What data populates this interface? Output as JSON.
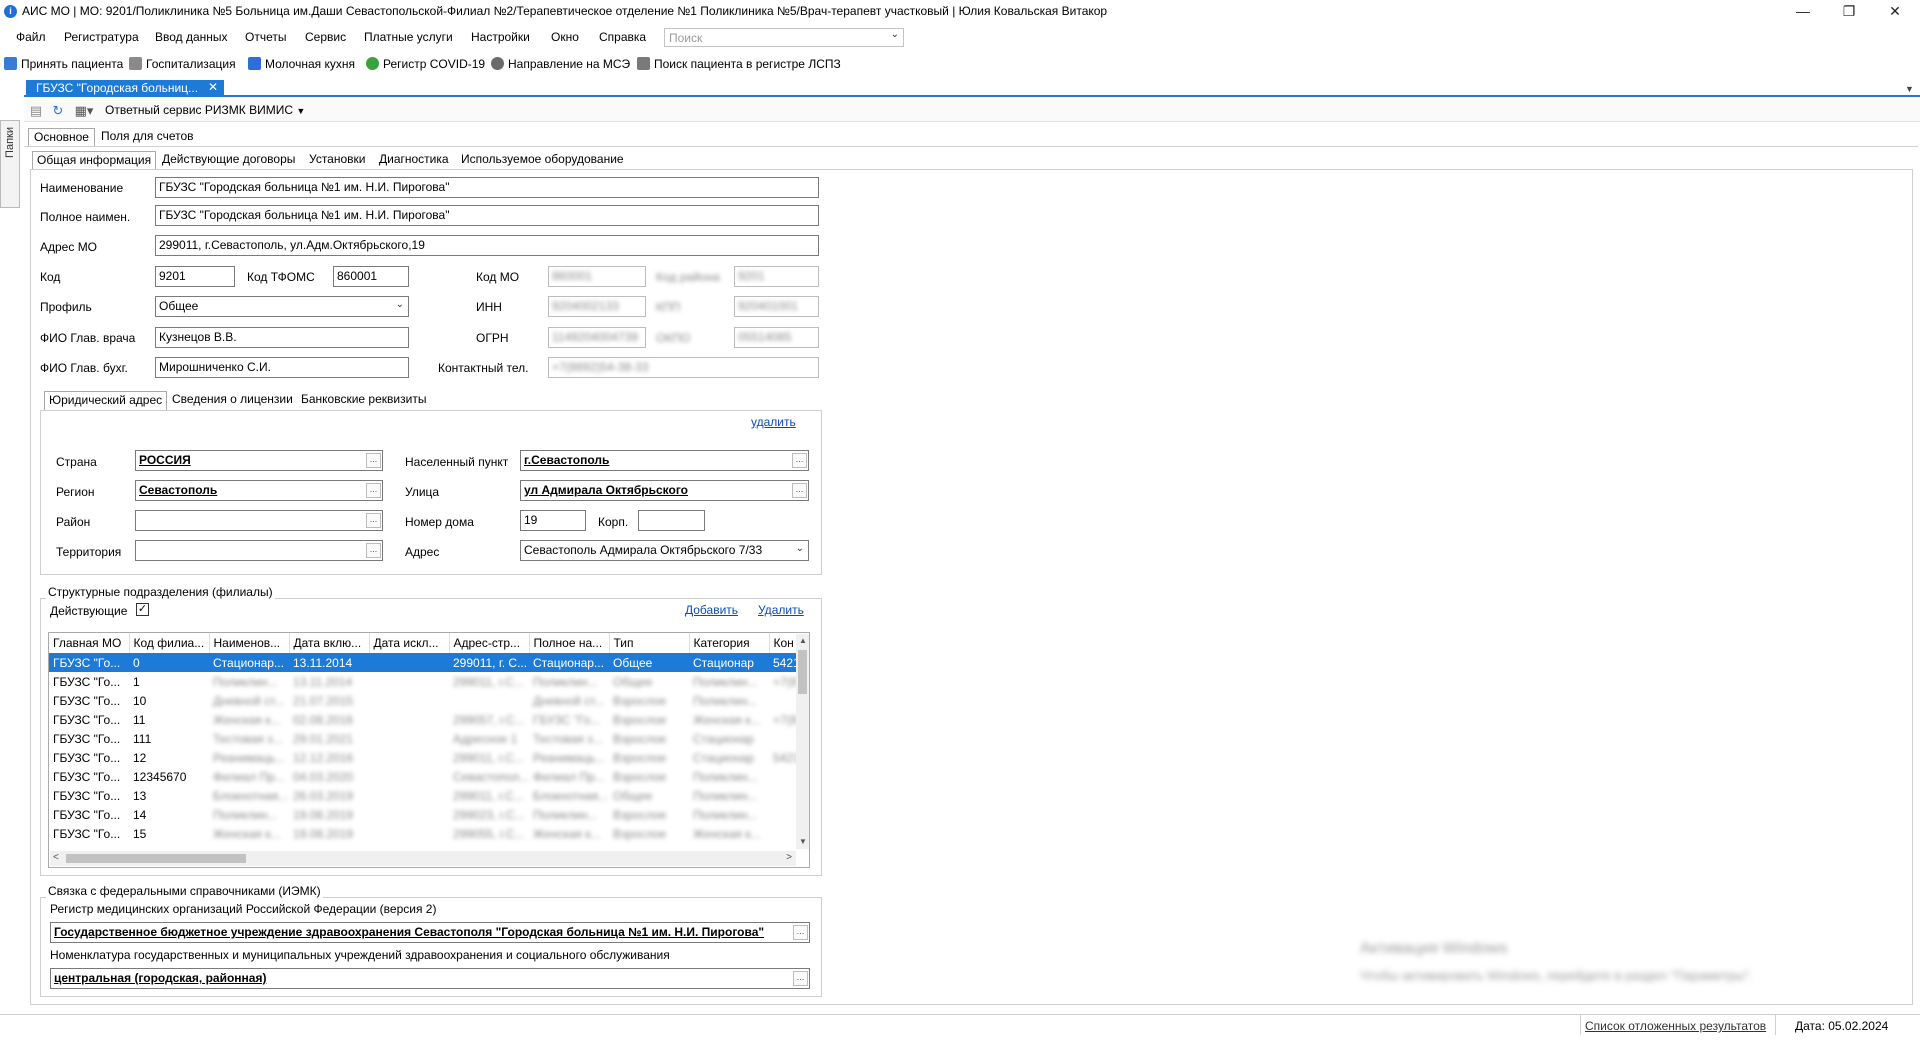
{
  "window": {
    "title": "АИС МО | МО: 9201/Поликлиника №5 Больница им.Даши Севастопольской-Филиал №2/Терапевтическое отделение №1 Поликлиника №5/Врач-терапевт участковый | Юлия Ковальская Витакор",
    "minimize": "—",
    "maximize": "❐",
    "close": "✕"
  },
  "menu": [
    "Файл",
    "Регистратура",
    "Ввод данных",
    "Отчеты",
    "Сервис",
    "Платные услуги",
    "Настройки",
    "Окно",
    "Справка"
  ],
  "search": {
    "placeholder": "Поиск"
  },
  "toolbar": [
    "Принять пациента",
    "Госпитализация",
    "Молочная кухня",
    "Регистр COVID-19",
    "Направление на МСЭ",
    "Поиск пациента в регистре ЛСПЗ"
  ],
  "doc_tab": {
    "label": "ГБУЗС \"Городская больниц...",
    "close": "✕"
  },
  "left_panel": {
    "label": "Папки"
  },
  "icon_toolbar": {
    "service": "Ответный сервис РИЗМК ВИМИС"
  },
  "main_tabs": [
    "Основное",
    "Поля для счетов"
  ],
  "sub_tabs": [
    "Общая информация",
    "Действующие договоры",
    "Установки",
    "Диагностика",
    "Используемое оборудование"
  ],
  "form": {
    "name_label": "Наименование",
    "name": "ГБУЗС \"Городская больница №1 им. Н.И. Пирогова\"",
    "fullname_label": "Полное наимен.",
    "fullname": "ГБУЗС \"Городская больница №1 им. Н.И. Пирогова\"",
    "address_label": "Адрес МО",
    "address": "299011, г.Севастополь, ул.Адм.Октябрьского,19",
    "code_label": "Код",
    "code": "9201",
    "tfoms_label": "Код ТФОМС",
    "tfoms": "860001",
    "kodmo_label": "Код МО",
    "kodmo": "860001",
    "kodrayona_label": "Код района",
    "kodrayona": "9201",
    "profile_label": "Профиль",
    "profile": "Общее",
    "inn_label": "ИНН",
    "inn": "9204002133",
    "kpp_label": "КПП",
    "kpp": "920401001",
    "chief_label": "ФИО Глав. врача",
    "chief": "Кузнецов В.В.",
    "ogrn_label": "ОГРН",
    "ogrn": "1149204004739",
    "okpo_label": "ОКПО",
    "okpo": "05514085",
    "accountant_label": "ФИО Глав. бухг.",
    "accountant": "Мирошниченко С.И.",
    "phone_label": "Контактный тел.",
    "phone": "+7(8692)54-38-33"
  },
  "address_tabs": [
    "Юридический адрес",
    "Сведения о лицензии",
    "Банковские реквизиты"
  ],
  "address_panel": {
    "delete": "удалить",
    "country_label": "Страна",
    "country": "РОССИЯ",
    "region_label": "Регион",
    "region": "Севастополь",
    "district_label": "Район",
    "district": "",
    "territory_label": "Территория",
    "territory": "",
    "locality_label": "Населенный пункт",
    "locality": "г.Севастополь",
    "street_label": "Улица",
    "street": "ул Адмирала Октябрьского",
    "house_label": "Номер дома",
    "house": "19",
    "korp_label": "Корп.",
    "korp": "",
    "addr_label": "Адрес",
    "addr": "Севастополь Адмирала Октябрьского 7/33",
    "ellipsis": "..."
  },
  "branches": {
    "title": "Структурные подразделения (филиалы)",
    "active_label": "Действующие",
    "add": "Добавить",
    "delete": "Удалить",
    "columns": [
      "Главная МО",
      "Код филиа...",
      "Наименов...",
      "Дата вклю...",
      "Дата искл...",
      "Адрес-стр...",
      "Полное на...",
      "Тип",
      "Категория",
      "Кон"
    ],
    "rows": [
      [
        "ГБУЗС \"Го...",
        "0",
        "Стационар...",
        "13.11.2014",
        "",
        "299011, г. С...",
        "Стационар...",
        "Общее",
        "Стационар",
        "5421"
      ],
      [
        "ГБУЗС \"Го...",
        "1",
        "Поликлин...",
        "13.11.2014",
        "",
        "299011, г.С...",
        "Поликлин...",
        "Общее",
        "Поликлин...",
        "+7(8"
      ],
      [
        "ГБУЗС \"Го...",
        "10",
        "Дневной ст...",
        "21.07.2015",
        "",
        "",
        "Дневной ст...",
        "Взрослое",
        "Поликлин...",
        ""
      ],
      [
        "ГБУЗС \"Го...",
        "11",
        "Женская к...",
        "02.08.2016",
        "",
        "299057, г.С...",
        "ГБУЗС \"Го...",
        "Взрослое",
        "Женская к...",
        "+7(8"
      ],
      [
        "ГБУЗС \"Го...",
        "111",
        "Тестовая з...",
        "29.01.2021",
        "",
        "Адресное 1",
        "Тестовая з...",
        "Взрослое",
        "Стационар",
        ""
      ],
      [
        "ГБУЗС \"Го...",
        "12",
        "Реанимаць...",
        "12.12.2016",
        "",
        "299011, г.С...",
        "Реанимаць...",
        "Взрослое",
        "Стационар",
        "5421"
      ],
      [
        "ГБУЗС \"Го...",
        "12345670",
        "Филиал Пр...",
        "04.03.2020",
        "",
        "Севастопол...",
        "Филиал Пр...",
        "Взрослое",
        "Поликлин...",
        ""
      ],
      [
        "ГБУЗС \"Го...",
        "13",
        "Блокнотная...",
        "26.03.2019",
        "",
        "299011, г.С...",
        "Блокнотная...",
        "Общее",
        "Поликлин...",
        ""
      ],
      [
        "ГБУЗС \"Го...",
        "14",
        "Поликлин...",
        "19.08.2019",
        "",
        "299023, г.С...",
        "Поликлин...",
        "Взрослое",
        "Поликлин...",
        ""
      ],
      [
        "ГБУЗС \"Го...",
        "15",
        "Женская к...",
        "19.08.2019",
        "",
        "299055, г.С...",
        "Женская к...",
        "Взрослое",
        "Женская к...",
        ""
      ]
    ]
  },
  "federal": {
    "title": "Связка с федеральными справочниками (ИЭМК)",
    "reg_label": "Регистр медицинских организаций Российской Федерации (версия 2)",
    "reg_value": "Государственное бюджетное учреждение здравоохранения Севастополя \"Городская больница №1 им. Н.И. Пирогова\"",
    "nom_label": "Номенклатура государственных и муниципальных учреждений здравоохранения и социального обслуживания",
    "nom_value": "центральная (городская, районная)"
  },
  "status": {
    "deferred": "Список отложенных результатов",
    "date": "Дата: 05.02.2024"
  },
  "toast": {
    "title": "Активация Windows",
    "text": "Чтобы активировать Windows, перейдите в раздел \"Параметры\"."
  },
  "colors": {
    "accent": "#1e7ad7",
    "link": "#0a4bb5"
  }
}
